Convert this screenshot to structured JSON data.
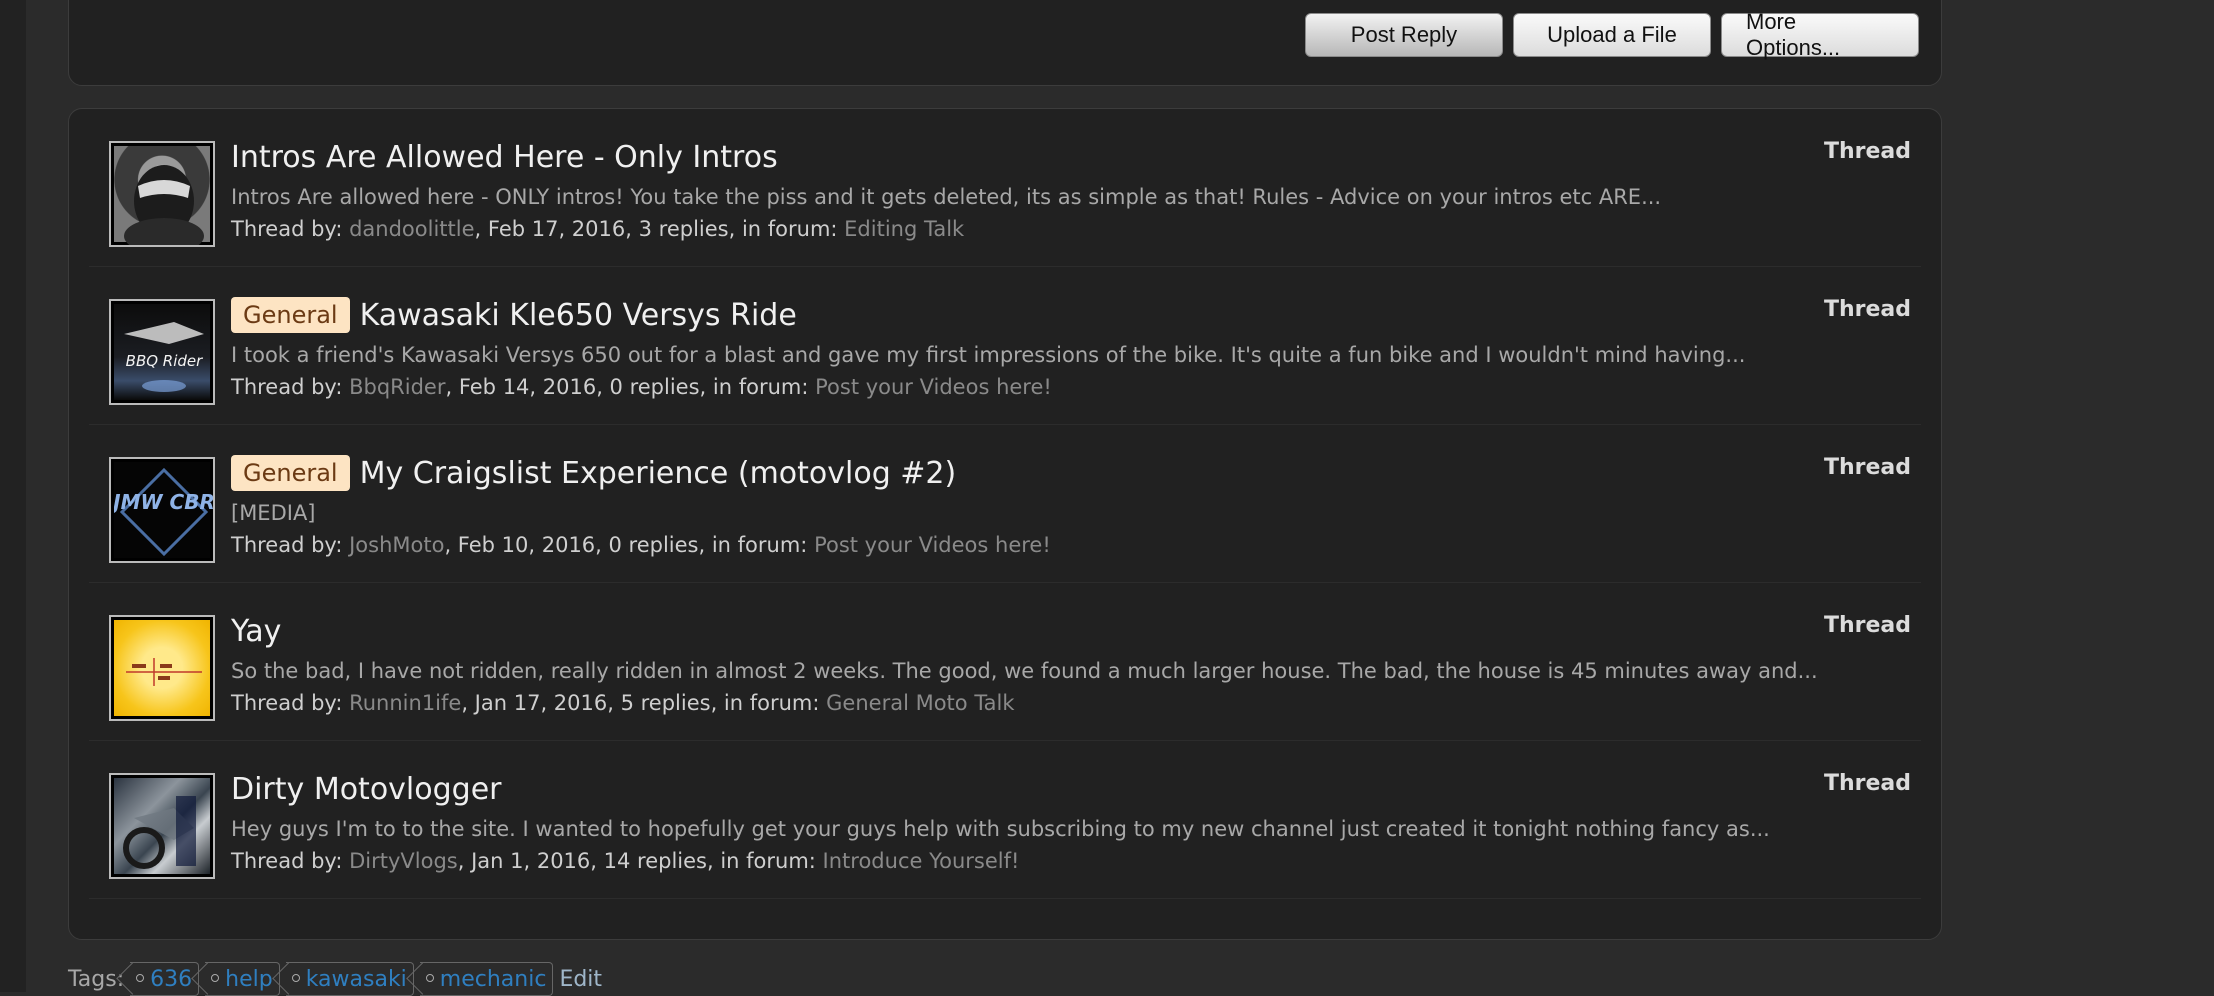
{
  "toolbar": {
    "post_reply": "Post Reply",
    "upload_file": "Upload a File",
    "more_options": "More Options..."
  },
  "results": [
    {
      "prefix": "",
      "title": "Intros Are Allowed Here - Only Intros",
      "snippet": "Intros Are allowed here - ONLY intros! You take the piss and it gets deleted, its as simple as that! Rules - Advice on your intros etc ARE...",
      "meta_prefix": "Thread by: ",
      "author": "dandoolittle",
      "meta_middle": ", Feb 17, 2016, 3 replies, in forum: ",
      "forum": "Editing Talk",
      "content_type": "Thread",
      "avatar": "helmet-avatar"
    },
    {
      "prefix": "General",
      "title": "Kawasaki Kle650 Versys Ride",
      "snippet": "I took a friend's Kawasaki Versys 650 out for a blast and gave my first impressions of the bike. It's quite a fun bike and I wouldn't mind having...",
      "meta_prefix": "Thread by: ",
      "author": "BbqRider",
      "meta_middle": ", Feb 14, 2016, 0 replies, in forum: ",
      "forum": "Post your Videos here!",
      "content_type": "Thread",
      "avatar": "bbq-rider-avatar",
      "avatar_text": "BBQ Rider"
    },
    {
      "prefix": "General",
      "title": "My Craigslist Experience (motovlog #2)",
      "snippet": "[MEDIA]",
      "meta_prefix": "Thread by: ",
      "author": "JoshMoto",
      "meta_middle": ", Feb 10, 2016, 0 replies, in forum: ",
      "forum": "Post your Videos here!",
      "content_type": "Thread",
      "avatar": "jmw-cbr-avatar",
      "avatar_text": "JMW CBR"
    },
    {
      "prefix": "",
      "title": "Yay",
      "snippet": "So the bad, I have not ridden, really ridden in almost 2 weeks. The good, we found a much larger house. The bad, the house is 45 minutes away and...",
      "meta_prefix": "Thread by: ",
      "author": "Runnin1ife",
      "meta_middle": ", Jan 17, 2016, 5 replies, in forum: ",
      "forum": "General Moto Talk",
      "content_type": "Thread",
      "avatar": "yellow-avatar"
    },
    {
      "prefix": "",
      "title": "Dirty Motovlogger",
      "snippet": "Hey guys I'm to to the site. I wanted to hopefully get your guys help with subscribing to my new channel just created it tonight nothing fancy as...",
      "meta_prefix": "Thread by: ",
      "author": "DirtyVlogs",
      "meta_middle": ", Jan 1, 2016, 14 replies, in forum: ",
      "forum": "Introduce Yourself!",
      "content_type": "Thread",
      "avatar": "motorcycle-photo-avatar"
    }
  ],
  "tags": {
    "label": "Tags:",
    "items": [
      "636",
      "help",
      "kawasaki",
      "mechanic"
    ],
    "edit": "Edit"
  },
  "colors": {
    "background": "#2b2b2b",
    "panel": "#212121",
    "prefix_bg": "#fde4c3",
    "tag_link": "#2f7fc0"
  }
}
